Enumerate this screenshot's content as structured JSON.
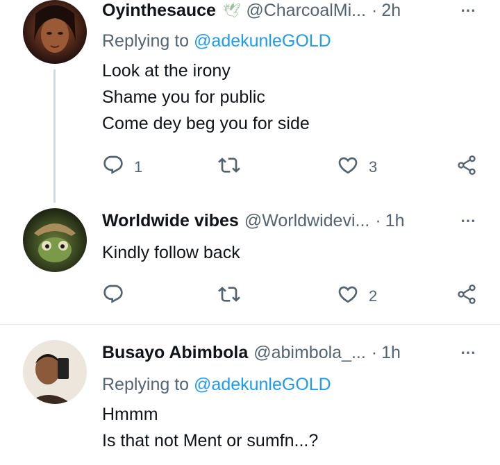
{
  "tweets": [
    {
      "name": "Oyinthesauce",
      "emoji": "🕊",
      "handle": "@CharcoalMi...",
      "time": "2h",
      "reply_label": "Replying to",
      "reply_mention": "@adekunleGOLD",
      "lines": [
        "Look at the irony",
        "Shame you for public",
        "Come dey beg you for side"
      ],
      "replies": "1",
      "retweets": "",
      "likes": "3"
    },
    {
      "name": "Worldwide vibes",
      "handle": "@Worldwidevi...",
      "time": "1h",
      "lines": [
        "Kindly follow back"
      ],
      "replies": "",
      "retweets": "",
      "likes": "2"
    },
    {
      "name": "Busayo Abimbola",
      "handle": "@abimbola_...",
      "time": "1h",
      "reply_label": "Replying to",
      "reply_mention": "@adekunleGOLD",
      "lines": [
        "Hmmm",
        "Is that not Ment or sumfn...?"
      ]
    }
  ],
  "separator": "·",
  "more_icon": "⋯",
  "icons": {
    "reply": "reply-icon",
    "retweet": "retweet-icon",
    "like": "heart-icon",
    "share": "share-icon",
    "more": "more-icon"
  },
  "colors": {
    "accent": "#1d9bf0",
    "muted": "#536471",
    "text": "#0f1419",
    "thread_line": "#cfd9de"
  }
}
